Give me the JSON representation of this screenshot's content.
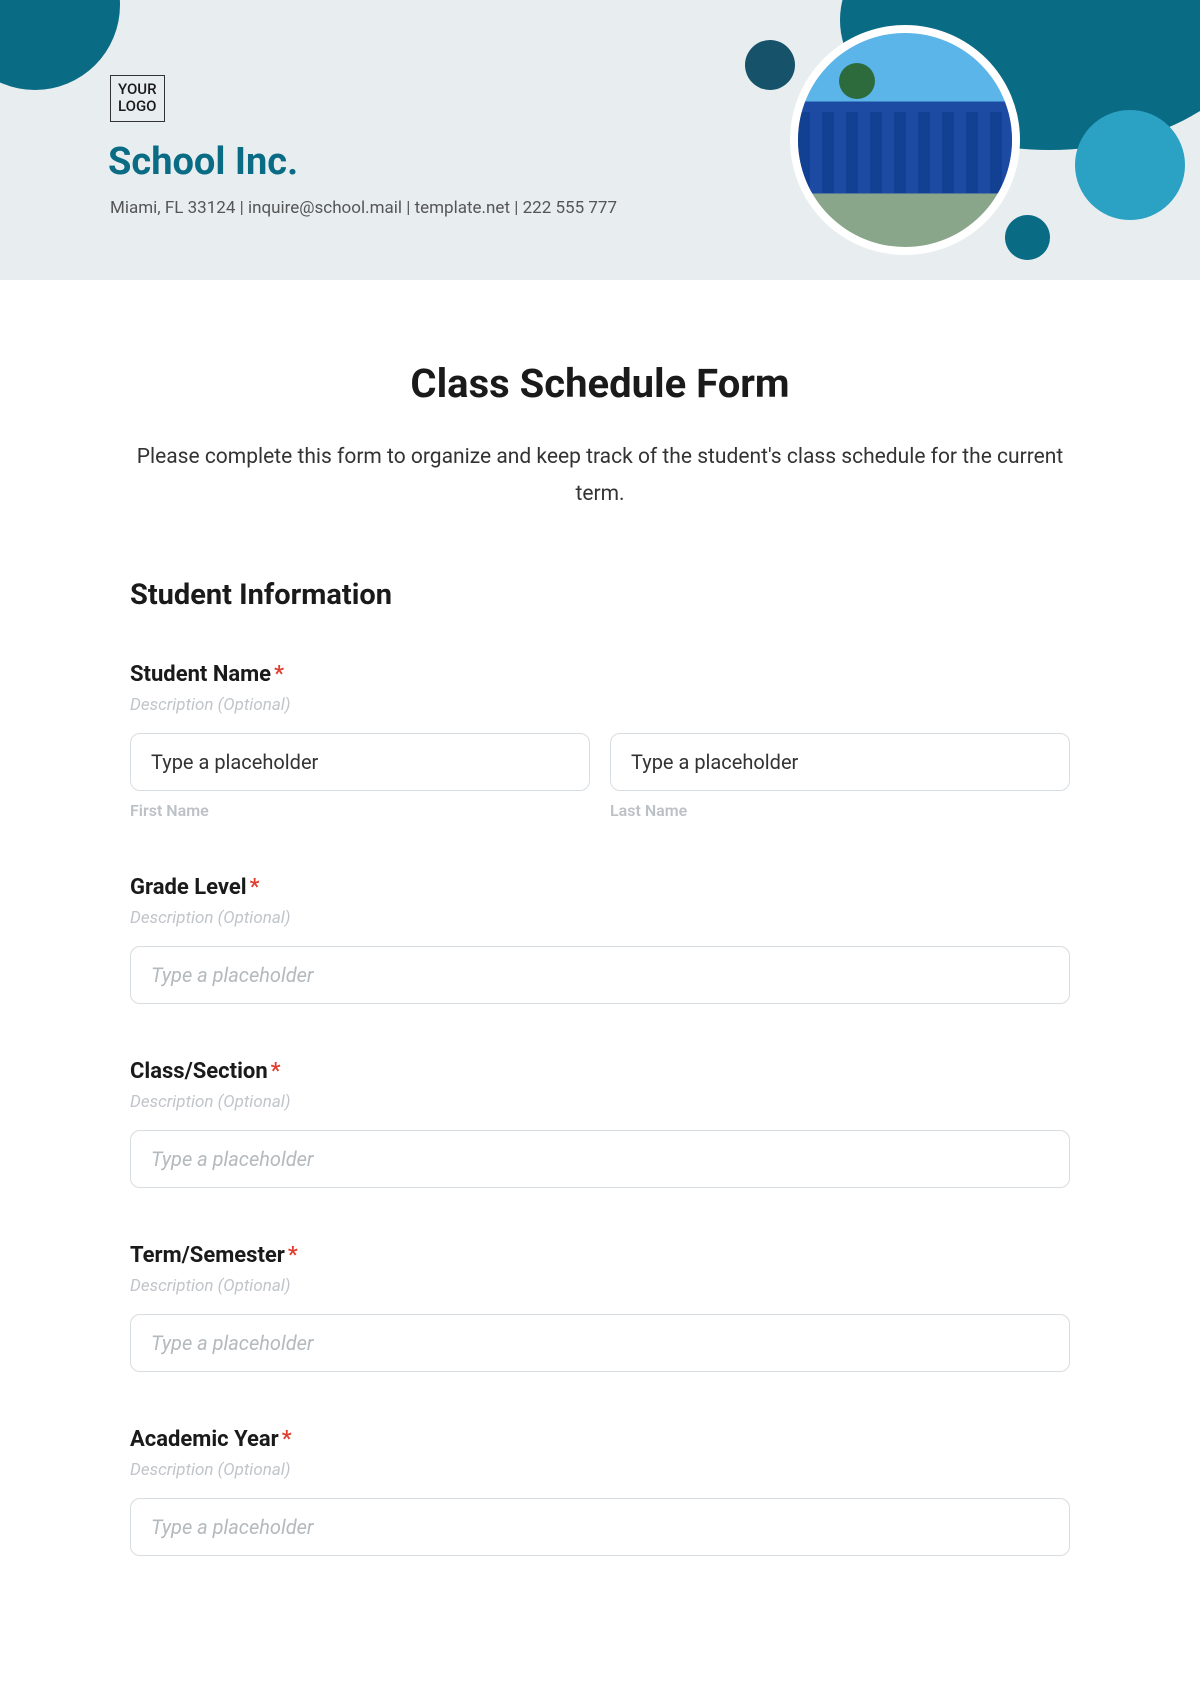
{
  "header": {
    "logo_text": "YOUR\nLOGO",
    "school_name": "School Inc.",
    "contact_line": "Miami, FL 33124 | inquire@school.mail | template.net | 222 555 777"
  },
  "form": {
    "title": "Class Schedule Form",
    "intro": "Please complete this form to organize and keep track of the student's class schedule for the current term.",
    "section_heading": "Student Information",
    "required_mark": "*",
    "desc_placeholder": "Description (Optional)",
    "input_placeholder": "Type a placeholder",
    "fields": {
      "student_name": {
        "label": "Student Name",
        "first_value": "Type a placeholder",
        "first_sub": "First Name",
        "last_value": "Type a placeholder",
        "last_sub": "Last Name"
      },
      "grade_level": {
        "label": "Grade Level"
      },
      "class_section": {
        "label": "Class/Section"
      },
      "term_semester": {
        "label": "Term/Semester"
      },
      "academic_year": {
        "label": "Academic Year"
      }
    }
  }
}
